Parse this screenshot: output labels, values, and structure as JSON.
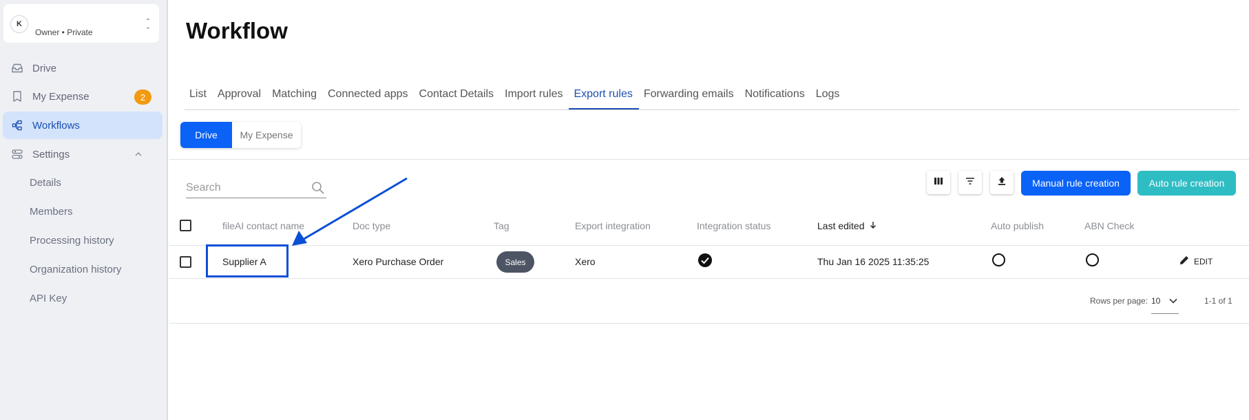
{
  "account": {
    "avatar_letter": "K",
    "subtitle": "Owner • Private"
  },
  "sidebar": {
    "items": [
      {
        "label": "Drive"
      },
      {
        "label": "My Expense",
        "badge": "2"
      },
      {
        "label": "Workflows",
        "active": true
      },
      {
        "label": "Settings"
      }
    ],
    "sub_items": [
      {
        "label": "Details"
      },
      {
        "label": "Members"
      },
      {
        "label": "Processing history"
      },
      {
        "label": "Organization history"
      },
      {
        "label": "API Key"
      }
    ]
  },
  "page": {
    "title": "Workflow"
  },
  "tabs": [
    {
      "label": "List"
    },
    {
      "label": "Approval"
    },
    {
      "label": "Matching"
    },
    {
      "label": "Connected apps"
    },
    {
      "label": "Contact Details"
    },
    {
      "label": "Import rules"
    },
    {
      "label": "Export rules",
      "active": true
    },
    {
      "label": "Forwarding emails"
    },
    {
      "label": "Notifications"
    },
    {
      "label": "Logs"
    }
  ],
  "segment": {
    "selected": "Drive",
    "options": [
      "Drive",
      "My Expense"
    ]
  },
  "toolbar": {
    "search_placeholder": "Search",
    "manual_label": "Manual rule creation",
    "auto_label": "Auto rule creation"
  },
  "table": {
    "columns": [
      "fileAI contact name",
      "Doc type",
      "Tag",
      "Export integration",
      "Integration status",
      "Last edited",
      "Auto publish",
      "ABN Check"
    ],
    "rows": [
      {
        "contact_name": "Supplier A",
        "doc_type": "Xero Purchase Order",
        "tag": "Sales",
        "export_integration": "Xero",
        "integration_status": "checked",
        "last_edited": "Thu Jan 16 2025 11:35:25",
        "auto_publish": false,
        "abn_check": false,
        "action": "EDIT"
      }
    ]
  },
  "pagination": {
    "rows_label": "Rows per page:",
    "rows_value": "10",
    "range_text": "1-1 of  1"
  },
  "colors": {
    "primary": "#0a62f6",
    "teal": "#2fbdc4",
    "badge": "#f39a12",
    "highlight": "#0a4fd6",
    "tag_bg": "#4d5564"
  }
}
